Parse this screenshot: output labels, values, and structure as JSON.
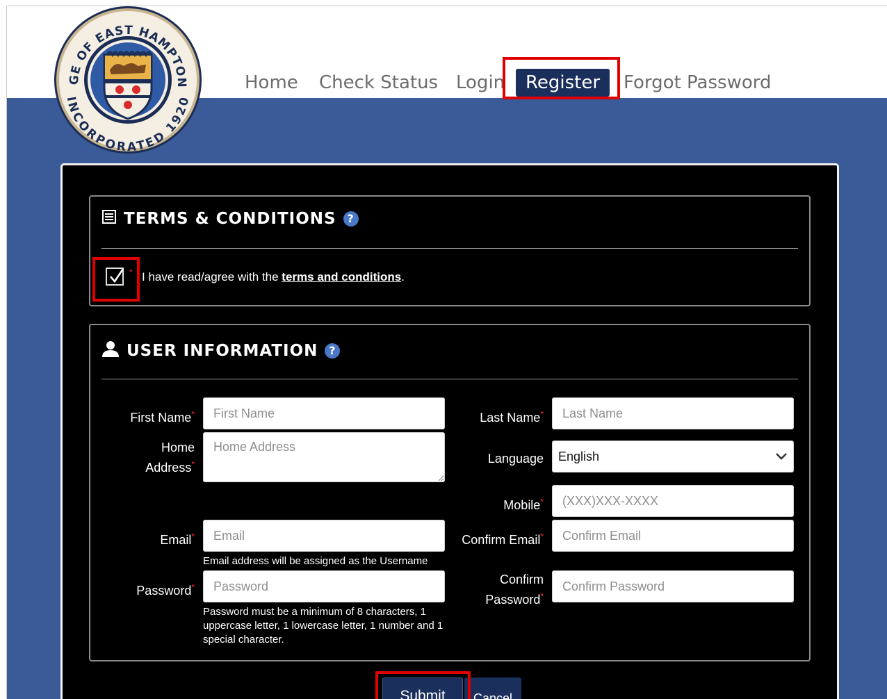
{
  "logo": {
    "top_text": "VILLAGE OF EAST HAMPTON, N.Y.",
    "bottom_text": "INCORPORATED 1920"
  },
  "nav": {
    "home": "Home",
    "check_status": "Check Status",
    "login": "Login",
    "register": "Register",
    "forgot_password": "Forgot Password"
  },
  "terms": {
    "title": "TERMS & CONDITIONS",
    "help": "?",
    "checked": true,
    "required_mark": "*",
    "agree_prefix": "I have read/agree with the ",
    "link": "terms and conditions",
    "agree_suffix": "."
  },
  "user": {
    "title": "USER INFORMATION",
    "help": "?",
    "required_mark": "*",
    "first_name": {
      "label": "First Name",
      "placeholder": "First Name",
      "value": ""
    },
    "last_name": {
      "label": "Last Name",
      "placeholder": "Last Name",
      "value": ""
    },
    "home_address": {
      "label_line1": "Home",
      "label_line2": "Address",
      "placeholder": "Home Address",
      "value": ""
    },
    "language": {
      "label": "Language",
      "value": "English"
    },
    "mobile": {
      "label": "Mobile",
      "placeholder": "(XXX)XXX-XXXX",
      "value": ""
    },
    "email": {
      "label": "Email",
      "placeholder": "Email",
      "value": "",
      "hint": "Email address will be assigned as the Username"
    },
    "confirm_email": {
      "label": "Confirm Email",
      "placeholder": "Confirm Email",
      "value": ""
    },
    "password": {
      "label": "Password",
      "placeholder": "Password",
      "value": "",
      "hint": "Password must be a minimum of 8 characters, 1 uppercase letter, 1 lowercase letter, 1 number and 1 special character."
    },
    "confirm_password": {
      "label_line1": "Confirm",
      "label_line2": "Password",
      "placeholder": "Confirm Password",
      "value": ""
    }
  },
  "actions": {
    "submit": "Submit",
    "cancel": "Cancel"
  },
  "colors": {
    "header_blue": "#3a5b98",
    "nav_active": "#1b2f5c",
    "highlight_red": "#e00000"
  }
}
